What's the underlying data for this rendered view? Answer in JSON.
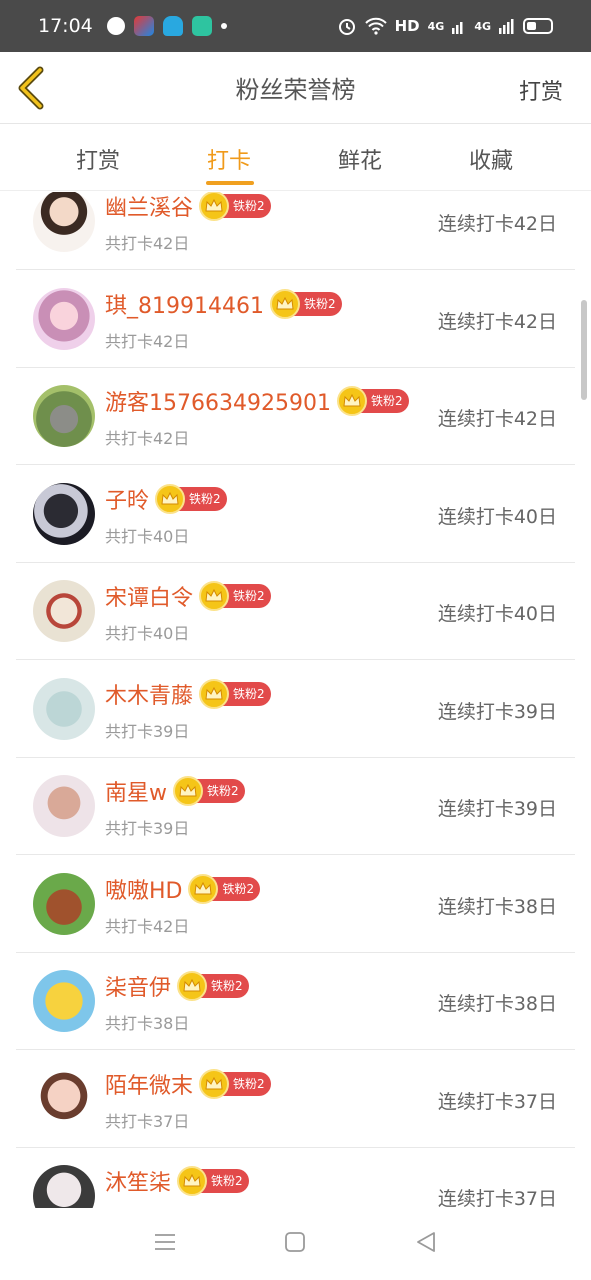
{
  "status": {
    "time": "17:04",
    "network": "HD",
    "signal1": "4G",
    "signal2": "4G"
  },
  "header": {
    "title": "粉丝荣誉榜",
    "action": "打赏"
  },
  "tabs": [
    "打赏",
    "打卡",
    "鲜花",
    "收藏"
  ],
  "active_tab": 1,
  "colors": {
    "accent": "#f09a1a",
    "name": "#e05a2a",
    "badge": "#e24a4a",
    "crown": "#f5c518"
  },
  "rows": [
    {
      "name": "幽兰溪谷",
      "badge": "铁粉2",
      "total": "共打卡42日",
      "streak": "连续打卡42日"
    },
    {
      "name": "琪_819914461",
      "badge": "铁粉2",
      "total": "共打卡42日",
      "streak": "连续打卡42日"
    },
    {
      "name": "游客1576634925901",
      "badge": "铁粉2",
      "total": "共打卡42日",
      "streak": "连续打卡42日"
    },
    {
      "name": "子昤",
      "badge": "铁粉2",
      "total": "共打卡40日",
      "streak": "连续打卡40日"
    },
    {
      "name": "宋谭白令",
      "badge": "铁粉2",
      "total": "共打卡40日",
      "streak": "连续打卡40日"
    },
    {
      "name": "木木青藤",
      "badge": "铁粉2",
      "total": "共打卡39日",
      "streak": "连续打卡39日"
    },
    {
      "name": "南星w",
      "badge": "铁粉2",
      "total": "共打卡39日",
      "streak": "连续打卡39日"
    },
    {
      "name": "嗷嗷HD",
      "badge": "铁粉2",
      "total": "共打卡42日",
      "streak": "连续打卡38日"
    },
    {
      "name": "柒音伊",
      "badge": "铁粉2",
      "total": "共打卡38日",
      "streak": "连续打卡38日"
    },
    {
      "name": "陌年微末",
      "badge": "铁粉2",
      "total": "共打卡37日",
      "streak": "连续打卡37日"
    },
    {
      "name": "沐笙柒",
      "badge": "铁粉2",
      "total": "",
      "streak": "连续打卡37日"
    }
  ],
  "icons": {
    "back": "chevron-left-icon",
    "crown": "crown-icon",
    "nav_menu": "menu-icon",
    "nav_home": "home-square-icon",
    "nav_back": "back-triangle-icon"
  }
}
